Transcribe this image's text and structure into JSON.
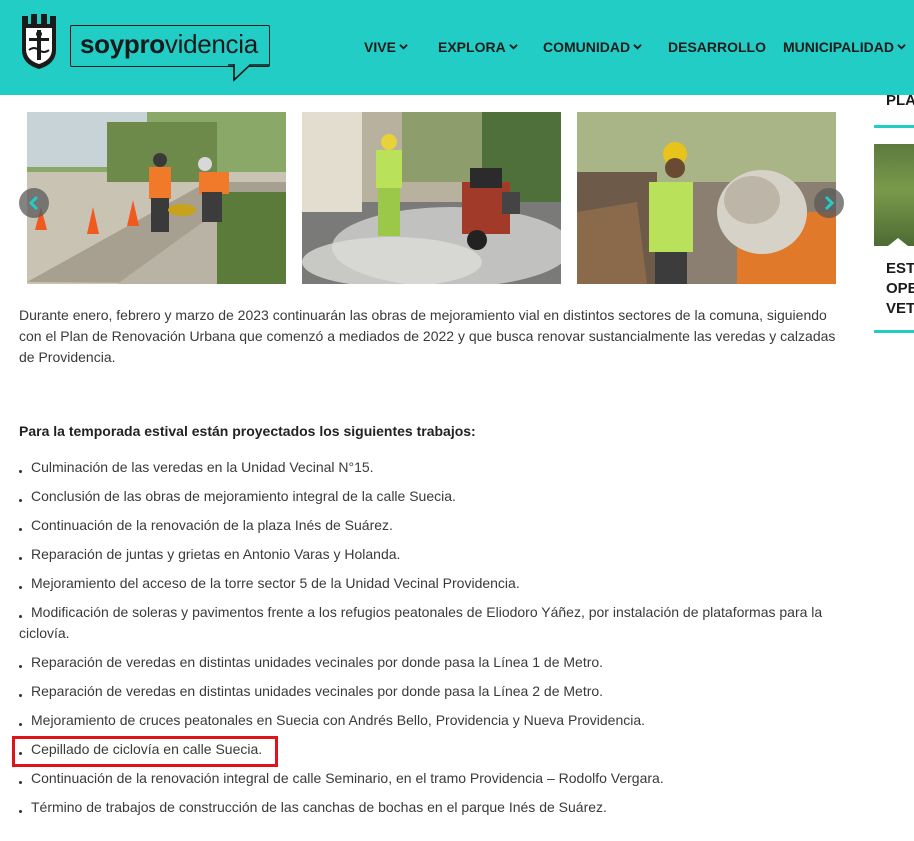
{
  "header": {
    "logo_bold": "soypro",
    "logo_regular": "videncia",
    "nav": [
      {
        "label": "VIVE",
        "has_dropdown": true
      },
      {
        "label": "EXPLORA",
        "has_dropdown": true
      },
      {
        "label": "COMUNIDAD",
        "has_dropdown": true
      },
      {
        "label": "DESARROLLO",
        "has_dropdown": false
      },
      {
        "label": "MUNICIPALIDAD",
        "has_dropdown": true
      }
    ],
    "colors": {
      "background": "#22cdc6",
      "text": "#1c1c1c"
    }
  },
  "sidebar": {
    "title_1": "PLA",
    "title_2_lines": [
      "EST",
      "OPE",
      "VET"
    ],
    "accent": "#22cdc6"
  },
  "gallery": {
    "prev_icon": "chevron-left-icon",
    "next_icon": "chevron-right-icon",
    "images": [
      {
        "subject": "workers with orange vests and cones at a sidewalk construction site"
      },
      {
        "subject": "worker in green vest operating a concrete cutting machine with dust"
      },
      {
        "subject": "worker in green vest pouring from a cement mixer"
      }
    ]
  },
  "article": {
    "intro": "Durante enero, febrero y marzo de 2023 continuarán las obras de mejoramiento vial en distintos sectores de la comuna, siguiendo con el Plan de Renovación Urbana que comenzó a mediados de 2022 y que busca renovar sustancialmente las veredas y calzadas de Providencia.",
    "subhead": "Para la temporada estival están proyectados los siguientes trabajos:",
    "items": [
      "Culminación de las veredas en la Unidad Vecinal N°15.",
      "Conclusión de las obras de mejoramiento integral de la calle Suecia.",
      "Continuación de la renovación de la plaza Inés de Suárez.",
      "Reparación de juntas y grietas en Antonio Varas y Holanda.",
      "Mejoramiento del acceso de la torre sector 5 de la Unidad Vecinal Providencia.",
      "Modificación de soleras y pavimentos frente a los refugios peatonales de Eliodoro Yáñez, por instalación de plataformas para la ciclovía.",
      "Reparación de veredas en distintas unidades vecinales por donde pasa la Línea 1 de Metro.",
      "Reparación de veredas en distintas unidades vecinales por donde pasa la Línea 2 de Metro.",
      "Mejoramiento de cruces peatonales en Suecia con Andrés Bello, Providencia y Nueva Providencia.",
      "Cepillado de ciclovía en calle Suecia.",
      "Continuación de la renovación integral de calle Seminario, en el tramo Providencia – Rodolfo Vergara.",
      "Término de trabajos de construcción de las canchas de bochas en el parque Inés de Suárez."
    ],
    "highlighted_item_index": 9,
    "highlight_color": "#e0131b"
  }
}
